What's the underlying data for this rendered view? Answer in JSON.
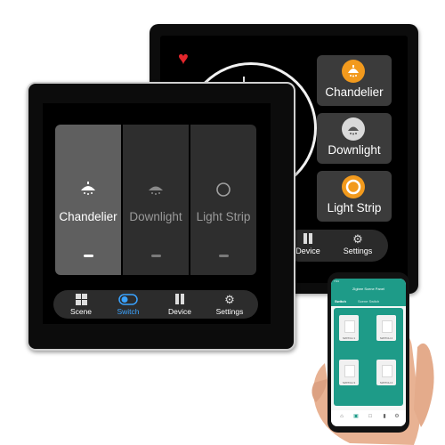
{
  "back_panel": {
    "buttons": [
      {
        "label": "Chandelier",
        "icon": "chandelier-icon",
        "color": "#f29a1d"
      },
      {
        "label": "Downlight",
        "icon": "downlight-icon",
        "color": "#d9d9d9"
      },
      {
        "label": "Light Strip",
        "icon": "ring-icon",
        "color": "#f29a1d"
      }
    ],
    "nav": [
      {
        "label": "Device",
        "icon": "device-icon"
      },
      {
        "label": "Settings",
        "icon": "gear-icon"
      }
    ]
  },
  "front_panel": {
    "tiles": [
      {
        "label": "Chandelier",
        "icon": "chandelier-icon",
        "active": true
      },
      {
        "label": "Downlight",
        "icon": "downlight-icon",
        "active": false
      },
      {
        "label": "Light Strip",
        "icon": "ring-icon",
        "active": false
      }
    ],
    "nav": [
      {
        "label": "Scene",
        "icon": "grid-icon"
      },
      {
        "label": "Switch",
        "icon": "toggle-icon",
        "active": true
      },
      {
        "label": "Device",
        "icon": "device-icon"
      },
      {
        "label": "Settings",
        "icon": "gear-icon"
      }
    ],
    "accent": "#3aa3ff"
  },
  "phone": {
    "status": "7:04",
    "title": "Zigbee Scene Panel",
    "tabs": [
      "Switch",
      "Scene Switch"
    ],
    "cards": [
      "SWITCH 1",
      "SWITCH 2",
      "SWITCH 3",
      "SWITCH 4"
    ],
    "accent": "#1e9b88"
  }
}
